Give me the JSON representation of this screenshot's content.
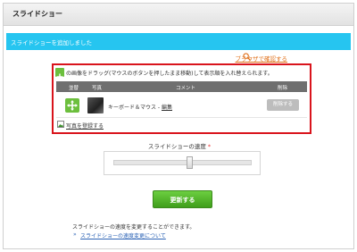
{
  "page": {
    "title": "スライドショー"
  },
  "notice": {
    "text": "スライドショーを追加しました"
  },
  "browser_check": {
    "label": "ブラウザで確認する",
    "icon": "search-icon"
  },
  "drag": {
    "hint": "の画像をドラッグ(マウスのボタンを押したまま移動)して表示順を入れ替えられます。"
  },
  "table": {
    "headers": {
      "order": "並替",
      "photo": "写真",
      "comment": "コメント",
      "delete": "削除"
    },
    "rows": [
      {
        "comment": "キーボード＆マウス",
        "separator": " - ",
        "edit_label": "編集",
        "delete_label": "削除する"
      }
    ]
  },
  "register": {
    "label": "写真を登録する"
  },
  "speed": {
    "label": "スライドショーの速度",
    "required_mark": "*",
    "level": 0.55
  },
  "actions": {
    "update_label": "更新する"
  },
  "help": {
    "description": "スライドショーの速度を変更することができます。",
    "bullet": "»",
    "link_label": "スライドショーの速度変更について"
  },
  "colors": {
    "notice_bg": "#26c5f0",
    "highlight_border": "#d9141c",
    "accent_green": "#6cbf3d"
  }
}
